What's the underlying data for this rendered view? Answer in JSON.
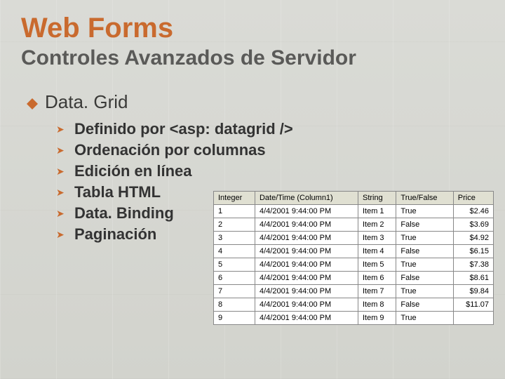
{
  "title": "Web Forms",
  "subtitle": "Controles Avanzados de Servidor",
  "section": "Data. Grid",
  "bullets": [
    "Definido por <asp: datagrid />",
    "Ordenación por columnas",
    "Edición en línea",
    "Tabla HTML",
    "Data. Binding",
    "Paginación"
  ],
  "grid": {
    "headers": [
      "Integer",
      "Date/Time (Column1)",
      "String",
      "True/False",
      "Price"
    ],
    "rows": [
      [
        "1",
        "4/4/2001 9:44:00 PM",
        "Item 1",
        "True",
        "$2.46"
      ],
      [
        "2",
        "4/4/2001 9:44:00 PM",
        "Item 2",
        "False",
        "$3.69"
      ],
      [
        "3",
        "4/4/2001 9:44:00 PM",
        "Item 3",
        "True",
        "$4.92"
      ],
      [
        "4",
        "4/4/2001 9:44:00 PM",
        "Item 4",
        "False",
        "$6.15"
      ],
      [
        "5",
        "4/4/2001 9:44:00 PM",
        "Item 5",
        "True",
        "$7.38"
      ],
      [
        "6",
        "4/4/2001 9:44:00 PM",
        "Item 6",
        "False",
        "$8.61"
      ],
      [
        "7",
        "4/4/2001 9:44:00 PM",
        "Item 7",
        "True",
        "$9.84"
      ],
      [
        "8",
        "4/4/2001 9:44:00 PM",
        "Item 8",
        "False",
        "$11.07"
      ],
      [
        "9",
        "4/4/2001 9:44:00 PM",
        "Item 9",
        "True",
        ""
      ]
    ]
  }
}
